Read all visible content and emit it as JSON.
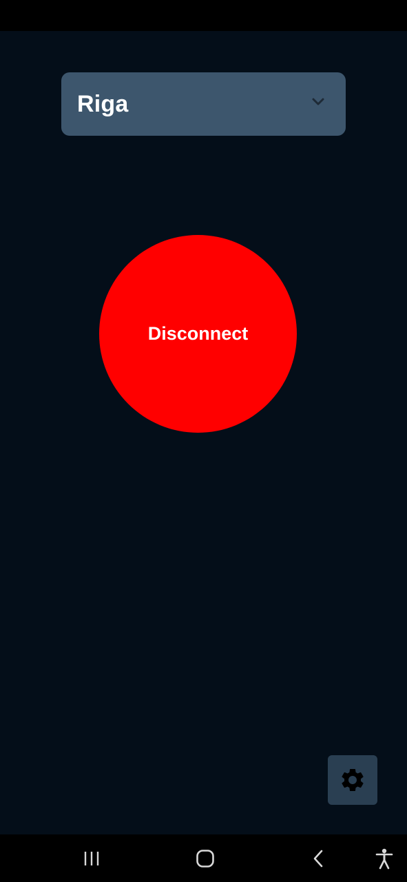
{
  "server_select": {
    "selected": "Riga",
    "icon": "chevron-down-icon"
  },
  "connect_button": {
    "label": "Disconnect",
    "color": "#ff0000"
  },
  "settings_button": {
    "icon": "gear-icon"
  },
  "nav_bar": {
    "icons": [
      "recent-apps-icon",
      "home-icon",
      "back-icon",
      "accessibility-icon"
    ]
  },
  "colors": {
    "background": "#040e19",
    "select_background": "#3d566d",
    "settings_background": "#2a3f52"
  }
}
